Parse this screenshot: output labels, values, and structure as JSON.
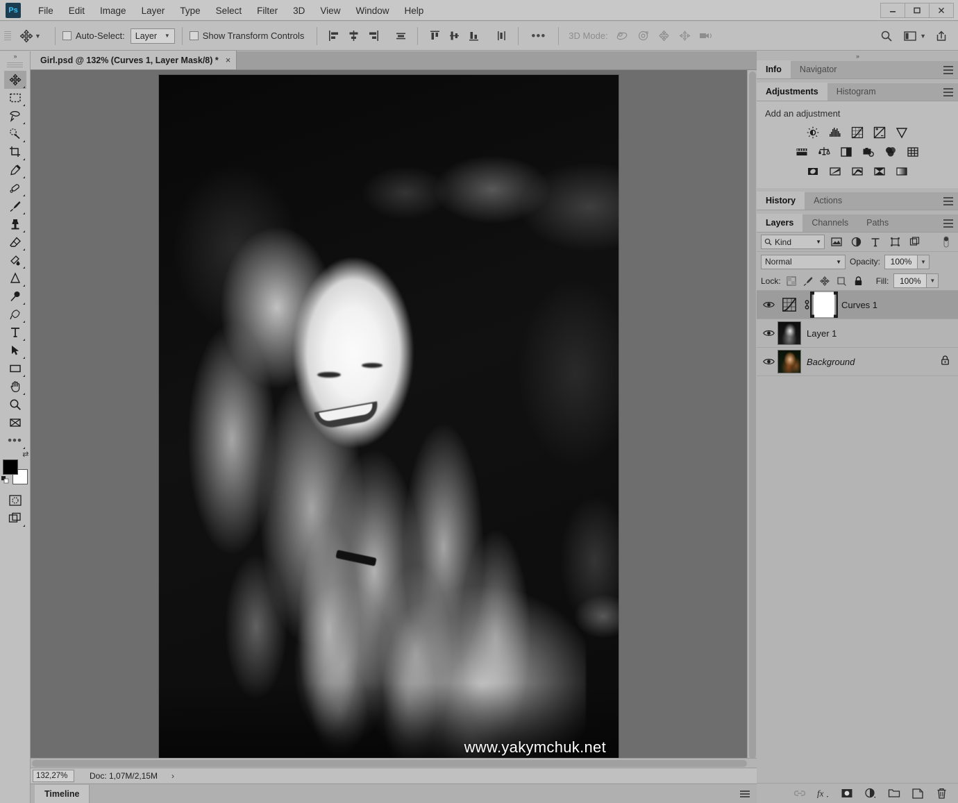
{
  "app": {
    "logo_text": "Ps"
  },
  "menubar": {
    "items": [
      {
        "label": "File"
      },
      {
        "label": "Edit"
      },
      {
        "label": "Image"
      },
      {
        "label": "Layer"
      },
      {
        "label": "Type"
      },
      {
        "label": "Select"
      },
      {
        "label": "Filter"
      },
      {
        "label": "3D"
      },
      {
        "label": "View"
      },
      {
        "label": "Window"
      },
      {
        "label": "Help"
      }
    ]
  },
  "window_controls": {
    "minimize": "minimize-icon",
    "maximize": "maximize-icon",
    "close": "close-icon"
  },
  "options_bar": {
    "tool_icon": "move-tool-icon",
    "auto_select_label": "Auto-Select:",
    "auto_select_checked": false,
    "auto_select_value": "Layer",
    "show_transform_label": "Show Transform Controls",
    "show_transform_checked": false,
    "align_icons": [
      "align-left-edges-icon",
      "align-horizontal-centers-icon",
      "align-right-edges-icon",
      "align-top-edges-icon"
    ],
    "distribute_icons": [
      "distribute-top-edges-icon",
      "distribute-vertical-centers-icon",
      "distribute-bottom-edges-icon",
      "distribute-horizontal-centers-icon"
    ],
    "more_label": "•••",
    "mode_3d_label": "3D Mode:",
    "mode_3d_icons": [
      "orbit-3d-icon",
      "roll-3d-icon",
      "pan-3d-icon",
      "slide-3d-icon",
      "camera-3d-icon"
    ],
    "right_icons": [
      "search-icon",
      "workspace-switcher-icon",
      "chevron-down-icon",
      "share-icon"
    ]
  },
  "document_tab": {
    "title": "Girl.psd @ 132% (Curves 1, Layer Mask/8) *",
    "close_label": "×"
  },
  "toolbar": {
    "collapse_label": "»",
    "tools": [
      {
        "name": "move-tool",
        "active": true
      },
      {
        "name": "rectangular-marquee-tool",
        "active": false
      },
      {
        "name": "lasso-tool",
        "active": false
      },
      {
        "name": "quick-selection-tool",
        "active": false
      },
      {
        "name": "crop-tool",
        "active": false
      },
      {
        "name": "eyedropper-tool",
        "active": false
      },
      {
        "name": "spot-healing-brush-tool",
        "active": false
      },
      {
        "name": "brush-tool",
        "active": false
      },
      {
        "name": "clone-stamp-tool",
        "active": false
      },
      {
        "name": "eraser-tool",
        "active": false
      },
      {
        "name": "gradient-tool",
        "active": false
      },
      {
        "name": "blur-sharpen-tool",
        "active": false
      },
      {
        "name": "dodge-burn-tool",
        "active": false
      },
      {
        "name": "pen-tool",
        "active": false
      },
      {
        "name": "type-tool",
        "active": false
      },
      {
        "name": "path-selection-tool",
        "active": false
      },
      {
        "name": "rectangle-shape-tool",
        "active": false
      },
      {
        "name": "hand-tool",
        "active": false
      },
      {
        "name": "zoom-tool",
        "active": false
      },
      {
        "name": "edit-toolbar-tool",
        "active": false
      }
    ],
    "more_tools_label": "•••",
    "foreground_color": "#000000",
    "background_color": "#ffffff",
    "quick_mask_name": "quick-mask-mode-icon",
    "screen_mode_name": "screen-mode-icon"
  },
  "canvas": {
    "watermark": "www.yakymchuk.net",
    "background_color": "#6e6e6e"
  },
  "statusbar": {
    "zoom_value": "132,27%",
    "doc_info": "Doc: 1,07M/2,15M",
    "expand_arrow": "›"
  },
  "timeline": {
    "tab_label": "Timeline",
    "menu_name": "panel-menu-icon"
  },
  "right_panels": {
    "collapse_label": "»",
    "group_info": {
      "tabs": [
        {
          "label": "Info",
          "active": true
        },
        {
          "label": "Navigator",
          "active": false
        }
      ]
    },
    "group_adjustments": {
      "tabs": [
        {
          "label": "Adjustments",
          "active": true
        },
        {
          "label": "Histogram",
          "active": false
        }
      ],
      "heading": "Add an adjustment",
      "icons_row1": [
        "brightness-contrast-icon",
        "levels-icon",
        "curves-icon",
        "exposure-icon",
        "vibrance-icon"
      ],
      "icons_row2": [
        "hue-saturation-icon",
        "color-balance-icon",
        "black-white-icon",
        "photo-filter-icon",
        "channel-mixer-icon",
        "color-lookup-icon"
      ],
      "icons_row3": [
        "invert-icon",
        "posterize-icon",
        "threshold-icon",
        "selective-color-icon",
        "gradient-map-icon"
      ]
    },
    "group_history": {
      "tabs": [
        {
          "label": "History",
          "active": true
        },
        {
          "label": "Actions",
          "active": false
        }
      ]
    },
    "group_layers": {
      "tabs": [
        {
          "label": "Layers",
          "active": true
        },
        {
          "label": "Channels",
          "active": false
        },
        {
          "label": "Paths",
          "active": false
        }
      ],
      "filter": {
        "kind_label": "Kind",
        "filter_icons": [
          "pixel-layers-filter-icon",
          "adjustment-layers-filter-icon",
          "type-layers-filter-icon",
          "shape-layers-filter-icon",
          "smart-object-filter-icon"
        ],
        "toggle_name": "filter-toggle-icon"
      },
      "blend": {
        "mode_value": "Normal",
        "opacity_label": "Opacity:",
        "opacity_value": "100%"
      },
      "lock": {
        "label": "Lock:",
        "icons": [
          "lock-transparent-pixels-icon",
          "lock-image-pixels-icon",
          "lock-position-icon",
          "lock-artboard-nesting-icon",
          "lock-all-icon"
        ],
        "fill_label": "Fill:",
        "fill_value": "100%"
      },
      "layers": [
        {
          "name": "Curves 1",
          "visible": true,
          "selected": true,
          "italic": false,
          "has_adjustment_thumb": true,
          "adjustment_type": "curves-layer-thumbnail",
          "has_link": true,
          "has_mask": true,
          "mask_color": "#ffffff",
          "locked": false
        },
        {
          "name": "Layer 1",
          "visible": true,
          "selected": false,
          "italic": false,
          "has_adjustment_thumb": false,
          "has_link": false,
          "has_mask": false,
          "locked": false
        },
        {
          "name": "Background",
          "visible": true,
          "selected": false,
          "italic": true,
          "has_adjustment_thumb": false,
          "has_link": false,
          "has_mask": false,
          "locked": true
        }
      ],
      "footer_icons": [
        "link-layers-icon",
        "layer-style-fx-icon",
        "add-layer-mask-icon",
        "new-adjustment-layer-icon",
        "new-group-icon",
        "new-layer-icon",
        "delete-layer-icon"
      ]
    }
  },
  "colors": {
    "panel_bg": "#b4b4b4",
    "panel_bg_light": "#bdbdbd",
    "chrome": "#c0c0c0",
    "canvas_bg": "#6e6e6e",
    "selected_row": "#9c9c9c",
    "text": "#1d1d1d"
  }
}
